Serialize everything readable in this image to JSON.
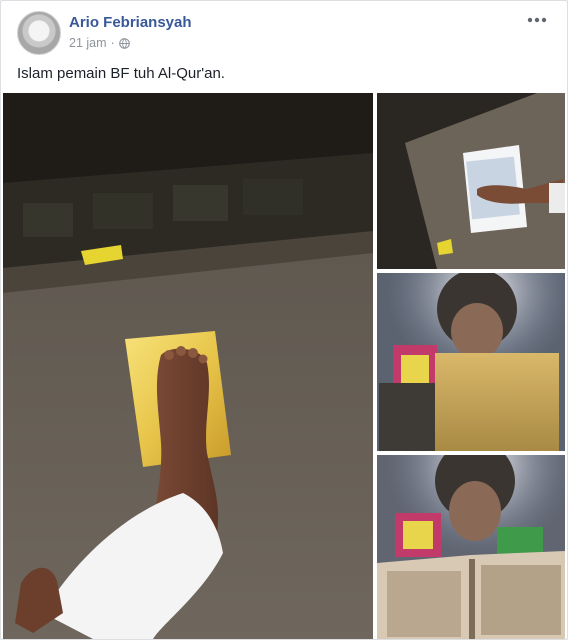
{
  "post": {
    "author_name": "Ario Febriansyah",
    "timestamp": "21 jam",
    "separator": "·",
    "privacy_icon": "globe-icon",
    "options_icon": "more-options-icon",
    "text": "Islam pemain BF tuh Al-Qur'an."
  },
  "photos": [
    {
      "name": "photo-main",
      "alt": "foot on golden book on concrete floor"
    },
    {
      "name": "photo-2",
      "alt": "hand on open book page"
    },
    {
      "name": "photo-3",
      "alt": "person holding golden book"
    },
    {
      "name": "photo-4",
      "alt": "person holding open book"
    }
  ],
  "colors": {
    "link": "#385898",
    "meta": "#90949c",
    "text": "#1d2129",
    "background": "#e9ebee"
  }
}
